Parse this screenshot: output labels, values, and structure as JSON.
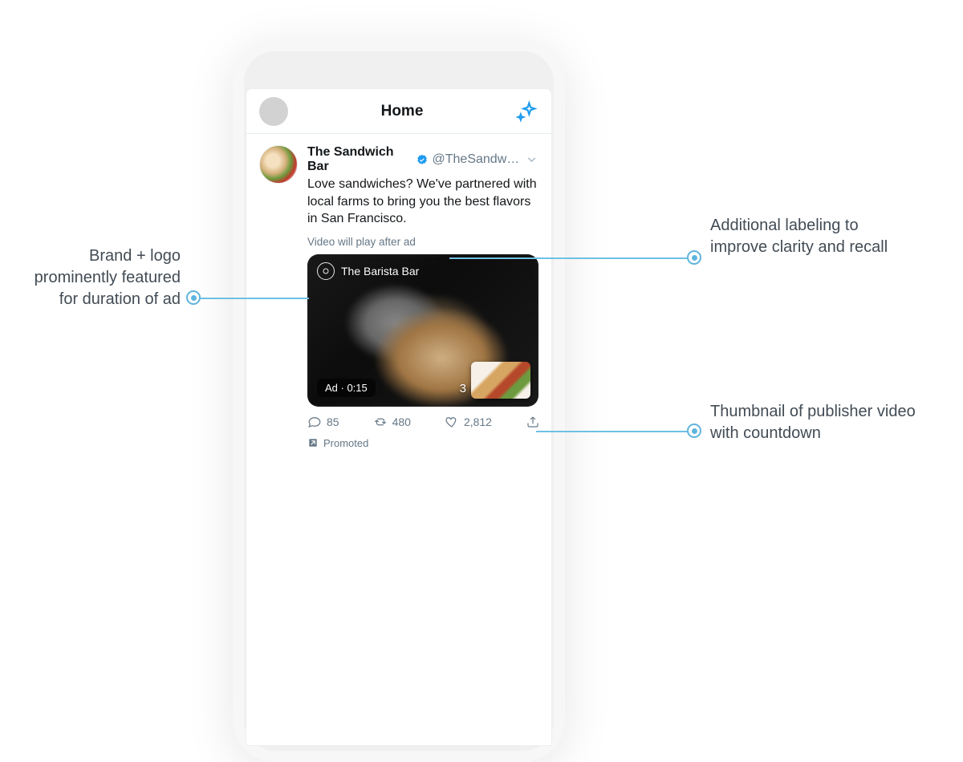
{
  "header": {
    "title": "Home"
  },
  "tweet": {
    "display_name": "The Sandwich Bar",
    "handle": "@TheSandwic...",
    "text": "Love sandwiches? We've partnered with local farms to bring you the best flavors in San Francisco.",
    "video_notice": "Video will play after ad",
    "brand_name": "The Barista Bar",
    "ad_pill": "Ad · 0:15",
    "countdown": "3"
  },
  "actions": {
    "reply_count": "85",
    "retweet_count": "480",
    "like_count": "2,812"
  },
  "promoted_label": "Promoted",
  "callouts": {
    "left1": "Brand + logo prominently featured for duration of ad",
    "right1": "Additional labeling to improve clarity and recall",
    "right2": "Thumbnail of publisher video with countdown"
  }
}
